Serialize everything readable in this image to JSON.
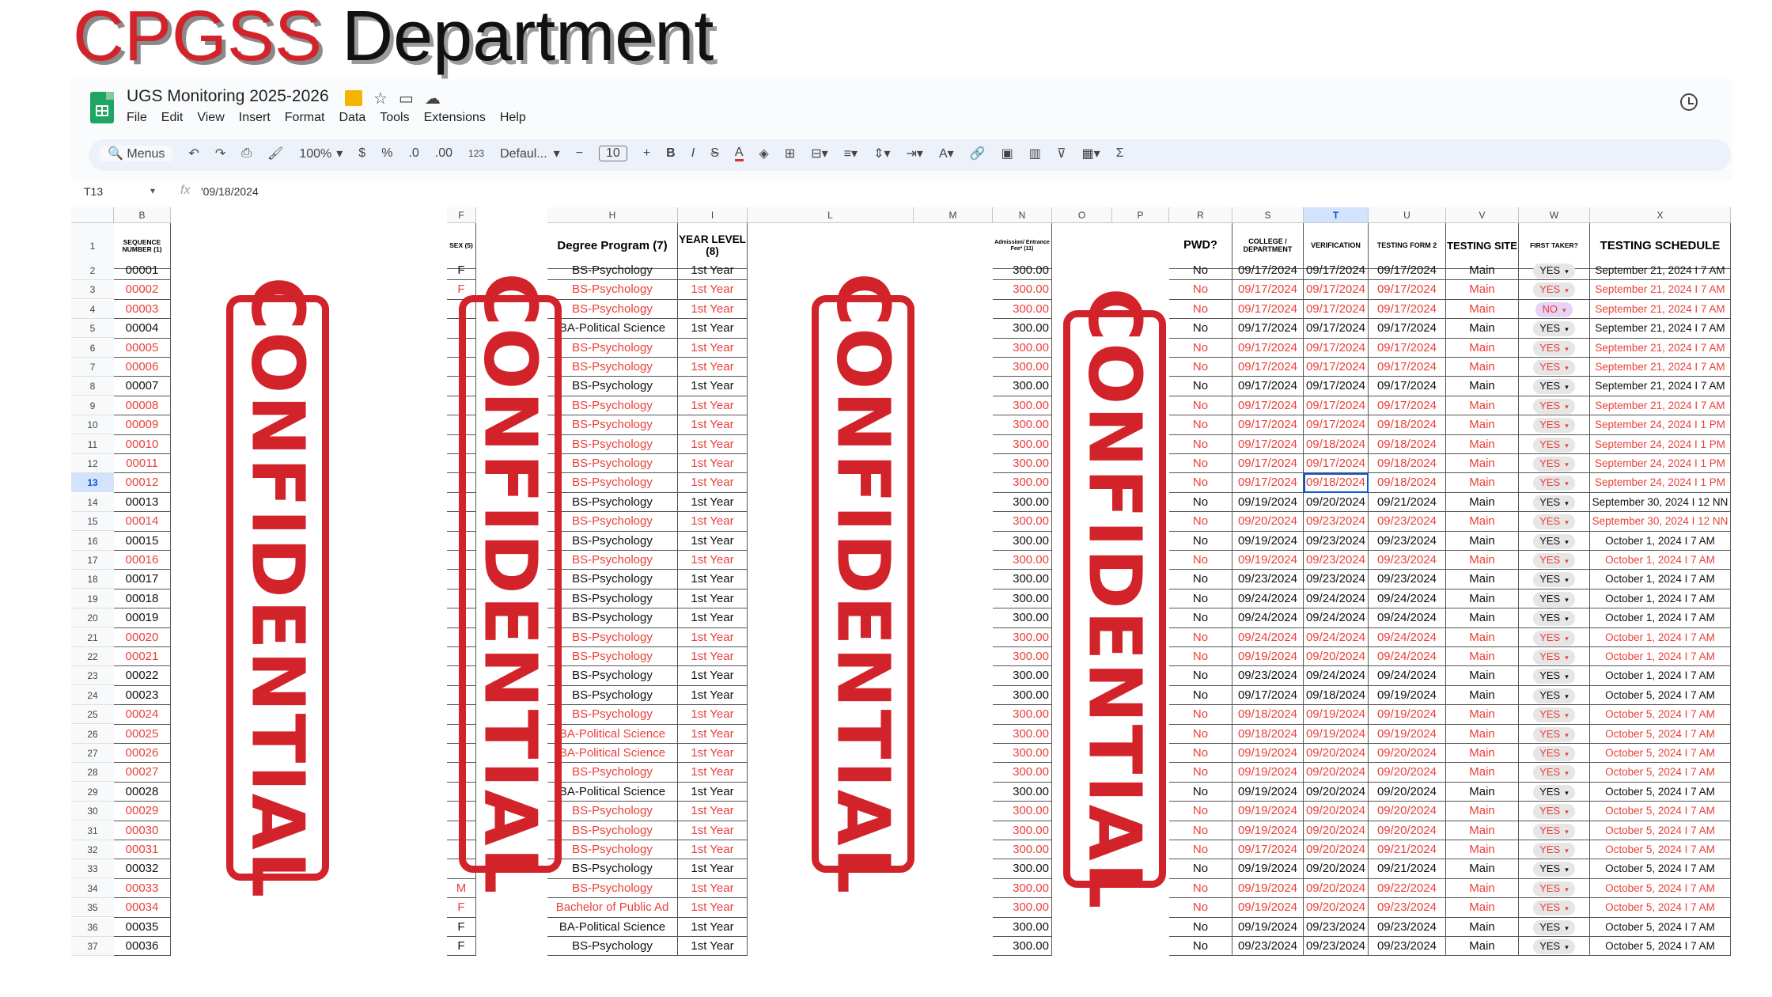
{
  "slide": {
    "title_red": "CPGSS",
    "title_dark": "Department"
  },
  "doc": {
    "title": "UGS Monitoring 2025-2026",
    "menu": [
      "File",
      "Edit",
      "View",
      "Insert",
      "Format",
      "Data",
      "Tools",
      "Extensions",
      "Help"
    ]
  },
  "toolbar": {
    "search": "Menus",
    "zoom": "100%",
    "currency": "$",
    "percent": "%",
    "dec_dec": ".0",
    "dec_inc": ".00",
    "number_format": "123",
    "font": "Defaul...",
    "font_size": "10",
    "bold": "B",
    "italic": "I",
    "strike": "S",
    "text_color": "A",
    "sum": "Σ"
  },
  "formula": {
    "cell_ref": "T13",
    "value": "'09/18/2024"
  },
  "col_letters": {
    "b": "B",
    "f": "F",
    "h": "H",
    "i": "I",
    "l": "L",
    "m": "M",
    "n": "N",
    "o": "O",
    "p": "P",
    "r": "R",
    "s": "S",
    "t": "T",
    "u": "U",
    "v": "V",
    "w": "W",
    "x": "X"
  },
  "headers": {
    "seq": "SEQUENCE NUMBER (1)",
    "sex": "SEX (5)",
    "degree": "Degree Program (7)",
    "year": "YEAR LEVEL (8)",
    "fee": "Admission/ Entrance Fee* (11)",
    "pwd": "PWD?",
    "college": "COLLEGE / DEPARTMENT",
    "verification": "VERIFICATION",
    "form2": "TESTING FORM 2",
    "site": "TESTING SITE",
    "first": "FIRST TAKER?",
    "schedule": "TESTING SCHEDULE"
  },
  "stamp_text": "CONFIDENTIAL",
  "colors": {
    "red_text": "#e8403a",
    "stamp": "#d2232a",
    "accent": "#0b57d0"
  },
  "rows": [
    {
      "n": "2",
      "seq": "00001",
      "sex": "F",
      "deg": "BS-Psychology",
      "yr": "1st Year",
      "fee": "300.00",
      "pwd": "No",
      "col": "09/17/2024",
      "ver": "09/17/2024",
      "f2": "09/17/2024",
      "site": "Main",
      "ft": "YES",
      "sch": "September 21, 2024 I 7 AM",
      "red": false
    },
    {
      "n": "3",
      "seq": "00002",
      "sex": "F",
      "deg": "BS-Psychology",
      "yr": "1st Year",
      "fee": "300.00",
      "pwd": "No",
      "col": "09/17/2024",
      "ver": "09/17/2024",
      "f2": "09/17/2024",
      "site": "Main",
      "ft": "YES",
      "sch": "September 21, 2024 I 7 AM",
      "red": true
    },
    {
      "n": "4",
      "seq": "00003",
      "sex": "",
      "deg": "BS-Psychology",
      "yr": "1st Year",
      "fee": "300.00",
      "pwd": "No",
      "col": "09/17/2024",
      "ver": "09/17/2024",
      "f2": "09/17/2024",
      "site": "Main",
      "ft": "NO",
      "sch": "September 21, 2024 I 7 AM",
      "red": true
    },
    {
      "n": "5",
      "seq": "00004",
      "sex": "",
      "deg": "BA-Political Science",
      "yr": "1st Year",
      "fee": "300.00",
      "pwd": "No",
      "col": "09/17/2024",
      "ver": "09/17/2024",
      "f2": "09/17/2024",
      "site": "Main",
      "ft": "YES",
      "sch": "September 21, 2024 I 7 AM",
      "red": false
    },
    {
      "n": "6",
      "seq": "00005",
      "sex": "",
      "deg": "BS-Psychology",
      "yr": "1st Year",
      "fee": "300.00",
      "pwd": "No",
      "col": "09/17/2024",
      "ver": "09/17/2024",
      "f2": "09/17/2024",
      "site": "Main",
      "ft": "YES",
      "sch": "September 21, 2024 I 7 AM",
      "red": true
    },
    {
      "n": "7",
      "seq": "00006",
      "sex": "",
      "deg": "BS-Psychology",
      "yr": "1st Year",
      "fee": "300.00",
      "pwd": "No",
      "col": "09/17/2024",
      "ver": "09/17/2024",
      "f2": "09/17/2024",
      "site": "Main",
      "ft": "YES",
      "sch": "September 21, 2024 I 7 AM",
      "red": true
    },
    {
      "n": "8",
      "seq": "00007",
      "sex": "",
      "deg": "BS-Psychology",
      "yr": "1st Year",
      "fee": "300.00",
      "pwd": "No",
      "col": "09/17/2024",
      "ver": "09/17/2024",
      "f2": "09/17/2024",
      "site": "Main",
      "ft": "YES",
      "sch": "September 21, 2024 I 7 AM",
      "red": false
    },
    {
      "n": "9",
      "seq": "00008",
      "sex": "",
      "deg": "BS-Psychology",
      "yr": "1st Year",
      "fee": "300.00",
      "pwd": "No",
      "col": "09/17/2024",
      "ver": "09/17/2024",
      "f2": "09/17/2024",
      "site": "Main",
      "ft": "YES",
      "sch": "September 21, 2024 I 7 AM",
      "red": true
    },
    {
      "n": "10",
      "seq": "00009",
      "sex": "",
      "deg": "BS-Psychology",
      "yr": "1st Year",
      "fee": "300.00",
      "pwd": "No",
      "col": "09/17/2024",
      "ver": "09/17/2024",
      "f2": "09/18/2024",
      "site": "Main",
      "ft": "YES",
      "sch": "September 24, 2024 I 1 PM",
      "red": true
    },
    {
      "n": "11",
      "seq": "00010",
      "sex": "",
      "deg": "BS-Psychology",
      "yr": "1st Year",
      "fee": "300.00",
      "pwd": "No",
      "col": "09/17/2024",
      "ver": "09/18/2024",
      "f2": "09/18/2024",
      "site": "Main",
      "ft": "YES",
      "sch": "September 24, 2024 I 1 PM",
      "red": true
    },
    {
      "n": "12",
      "seq": "00011",
      "sex": "",
      "deg": "BS-Psychology",
      "yr": "1st Year",
      "fee": "300.00",
      "pwd": "No",
      "col": "09/17/2024",
      "ver": "09/17/2024",
      "f2": "09/18/2024",
      "site": "Main",
      "ft": "YES",
      "sch": "September 24, 2024 I 1 PM",
      "red": true
    },
    {
      "n": "13",
      "seq": "00012",
      "sex": "",
      "deg": "BS-Psychology",
      "yr": "1st Year",
      "fee": "300.00",
      "pwd": "No",
      "col": "09/17/2024",
      "ver": "09/18/2024",
      "f2": "09/18/2024",
      "site": "Main",
      "ft": "YES",
      "sch": "September 24, 2024 I 1 PM",
      "red": true
    },
    {
      "n": "14",
      "seq": "00013",
      "sex": "",
      "deg": "BS-Psychology",
      "yr": "1st Year",
      "fee": "300.00",
      "pwd": "No",
      "col": "09/19/2024",
      "ver": "09/20/2024",
      "f2": "09/21/2024",
      "site": "Main",
      "ft": "YES",
      "sch": "September 30, 2024 I 12 NN",
      "red": false
    },
    {
      "n": "15",
      "seq": "00014",
      "sex": "",
      "deg": "BS-Psychology",
      "yr": "1st Year",
      "fee": "300.00",
      "pwd": "No",
      "col": "09/20/2024",
      "ver": "09/23/2024",
      "f2": "09/23/2024",
      "site": "Main",
      "ft": "YES",
      "sch": "September 30, 2024 I 12 NN",
      "red": true
    },
    {
      "n": "16",
      "seq": "00015",
      "sex": "",
      "deg": "BS-Psychology",
      "yr": "1st Year",
      "fee": "300.00",
      "pwd": "No",
      "col": "09/19/2024",
      "ver": "09/23/2024",
      "f2": "09/23/2024",
      "site": "Main",
      "ft": "YES",
      "sch": "October 1, 2024 I 7 AM",
      "red": false
    },
    {
      "n": "17",
      "seq": "00016",
      "sex": "",
      "deg": "BS-Psychology",
      "yr": "1st Year",
      "fee": "300.00",
      "pwd": "No",
      "col": "09/19/2024",
      "ver": "09/23/2024",
      "f2": "09/23/2024",
      "site": "Main",
      "ft": "YES",
      "sch": "October 1, 2024 I 7 AM",
      "red": true
    },
    {
      "n": "18",
      "seq": "00017",
      "sex": "",
      "deg": "BS-Psychology",
      "yr": "1st Year",
      "fee": "300.00",
      "pwd": "No",
      "col": "09/23/2024",
      "ver": "09/23/2024",
      "f2": "09/23/2024",
      "site": "Main",
      "ft": "YES",
      "sch": "October 1, 2024 I 7 AM",
      "red": false
    },
    {
      "n": "19",
      "seq": "00018",
      "sex": "",
      "deg": "BS-Psychology",
      "yr": "1st Year",
      "fee": "300.00",
      "pwd": "No",
      "col": "09/24/2024",
      "ver": "09/24/2024",
      "f2": "09/24/2024",
      "site": "Main",
      "ft": "YES",
      "sch": "October 1, 2024 I 7 AM",
      "red": false
    },
    {
      "n": "20",
      "seq": "00019",
      "sex": "",
      "deg": "BS-Psychology",
      "yr": "1st Year",
      "fee": "300.00",
      "pwd": "No",
      "col": "09/24/2024",
      "ver": "09/24/2024",
      "f2": "09/24/2024",
      "site": "Main",
      "ft": "YES",
      "sch": "October 1, 2024 I 7 AM",
      "red": false
    },
    {
      "n": "21",
      "seq": "00020",
      "sex": "",
      "deg": "BS-Psychology",
      "yr": "1st Year",
      "fee": "300.00",
      "pwd": "No",
      "col": "09/24/2024",
      "ver": "09/24/2024",
      "f2": "09/24/2024",
      "site": "Main",
      "ft": "YES",
      "sch": "October 1, 2024 I 7 AM",
      "red": true
    },
    {
      "n": "22",
      "seq": "00021",
      "sex": "",
      "deg": "BS-Psychology",
      "yr": "1st Year",
      "fee": "300.00",
      "pwd": "No",
      "col": "09/19/2024",
      "ver": "09/20/2024",
      "f2": "09/24/2024",
      "site": "Main",
      "ft": "YES",
      "sch": "October 1, 2024 I 7 AM",
      "red": true
    },
    {
      "n": "23",
      "seq": "00022",
      "sex": "",
      "deg": "BS-Psychology",
      "yr": "1st Year",
      "fee": "300.00",
      "pwd": "No",
      "col": "09/23/2024",
      "ver": "09/24/2024",
      "f2": "09/24/2024",
      "site": "Main",
      "ft": "YES",
      "sch": "October 1, 2024 I 7 AM",
      "red": false
    },
    {
      "n": "24",
      "seq": "00023",
      "sex": "",
      "deg": "BS-Psychology",
      "yr": "1st Year",
      "fee": "300.00",
      "pwd": "No",
      "col": "09/17/2024",
      "ver": "09/18/2024",
      "f2": "09/19/2024",
      "site": "Main",
      "ft": "YES",
      "sch": "October 5, 2024 I 7 AM",
      "red": false
    },
    {
      "n": "25",
      "seq": "00024",
      "sex": "",
      "deg": "BS-Psychology",
      "yr": "1st Year",
      "fee": "300.00",
      "pwd": "No",
      "col": "09/18/2024",
      "ver": "09/19/2024",
      "f2": "09/19/2024",
      "site": "Main",
      "ft": "YES",
      "sch": "October 5, 2024 I 7 AM",
      "red": true
    },
    {
      "n": "26",
      "seq": "00025",
      "sex": "",
      "deg": "BA-Political Science",
      "yr": "1st Year",
      "fee": "300.00",
      "pwd": "No",
      "col": "09/18/2024",
      "ver": "09/19/2024",
      "f2": "09/19/2024",
      "site": "Main",
      "ft": "YES",
      "sch": "October 5, 2024 I 7 AM",
      "red": true
    },
    {
      "n": "27",
      "seq": "00026",
      "sex": "",
      "deg": "BA-Political Science",
      "yr": "1st Year",
      "fee": "300.00",
      "pwd": "No",
      "col": "09/19/2024",
      "ver": "09/20/2024",
      "f2": "09/20/2024",
      "site": "Main",
      "ft": "YES",
      "sch": "October 5, 2024 I 7 AM",
      "red": true
    },
    {
      "n": "28",
      "seq": "00027",
      "sex": "",
      "deg": "BS-Psychology",
      "yr": "1st Year",
      "fee": "300.00",
      "pwd": "No",
      "col": "09/19/2024",
      "ver": "09/20/2024",
      "f2": "09/20/2024",
      "site": "Main",
      "ft": "YES",
      "sch": "October 5, 2024 I 7 AM",
      "red": true
    },
    {
      "n": "29",
      "seq": "00028",
      "sex": "",
      "deg": "BA-Political Science",
      "yr": "1st Year",
      "fee": "300.00",
      "pwd": "No",
      "col": "09/19/2024",
      "ver": "09/20/2024",
      "f2": "09/20/2024",
      "site": "Main",
      "ft": "YES",
      "sch": "October 5, 2024 I 7 AM",
      "red": false
    },
    {
      "n": "30",
      "seq": "00029",
      "sex": "",
      "deg": "BS-Psychology",
      "yr": "1st Year",
      "fee": "300.00",
      "pwd": "No",
      "col": "09/19/2024",
      "ver": "09/20/2024",
      "f2": "09/20/2024",
      "site": "Main",
      "ft": "YES",
      "sch": "October 5, 2024 I 7 AM",
      "red": true
    },
    {
      "n": "31",
      "seq": "00030",
      "sex": "",
      "deg": "BS-Psychology",
      "yr": "1st Year",
      "fee": "300.00",
      "pwd": "No",
      "col": "09/19/2024",
      "ver": "09/20/2024",
      "f2": "09/20/2024",
      "site": "Main",
      "ft": "YES",
      "sch": "October 5, 2024 I 7 AM",
      "red": true
    },
    {
      "n": "32",
      "seq": "00031",
      "sex": "",
      "deg": "BS-Psychology",
      "yr": "1st Year",
      "fee": "300.00",
      "pwd": "No",
      "col": "09/17/2024",
      "ver": "09/20/2024",
      "f2": "09/21/2024",
      "site": "Main",
      "ft": "YES",
      "sch": "October 5, 2024 I 7 AM",
      "red": true
    },
    {
      "n": "33",
      "seq": "00032",
      "sex": "",
      "deg": "BS-Psychology",
      "yr": "1st Year",
      "fee": "300.00",
      "pwd": "No",
      "col": "09/19/2024",
      "ver": "09/20/2024",
      "f2": "09/21/2024",
      "site": "Main",
      "ft": "YES",
      "sch": "October 5, 2024 I 7 AM",
      "red": false
    },
    {
      "n": "34",
      "seq": "00033",
      "sex": "M",
      "deg": "BS-Psychology",
      "yr": "1st Year",
      "fee": "300.00",
      "pwd": "No",
      "col": "09/19/2024",
      "ver": "09/20/2024",
      "f2": "09/22/2024",
      "site": "Main",
      "ft": "YES",
      "sch": "October 5, 2024 I 7 AM",
      "red": true
    },
    {
      "n": "35",
      "seq": "00034",
      "sex": "F",
      "deg": "Bachelor of Public Ad",
      "yr": "1st Year",
      "fee": "300.00",
      "pwd": "No",
      "col": "09/19/2024",
      "ver": "09/20/2024",
      "f2": "09/23/2024",
      "site": "Main",
      "ft": "YES",
      "sch": "October 5, 2024 I 7 AM",
      "red": true
    },
    {
      "n": "36",
      "seq": "00035",
      "sex": "F",
      "deg": "BA-Political Science",
      "yr": "1st Year",
      "fee": "300.00",
      "pwd": "No",
      "col": "09/19/2024",
      "ver": "09/23/2024",
      "f2": "09/23/2024",
      "site": "Main",
      "ft": "YES",
      "sch": "October 5, 2024 I 7 AM",
      "red": false
    },
    {
      "n": "37",
      "seq": "00036",
      "sex": "F",
      "deg": "BS-Psychology",
      "yr": "1st Year",
      "fee": "300.00",
      "pwd": "No",
      "col": "09/23/2024",
      "ver": "09/23/2024",
      "f2": "09/23/2024",
      "site": "Main",
      "ft": "YES",
      "sch": "October 5, 2024 I 7 AM",
      "red": false
    }
  ]
}
